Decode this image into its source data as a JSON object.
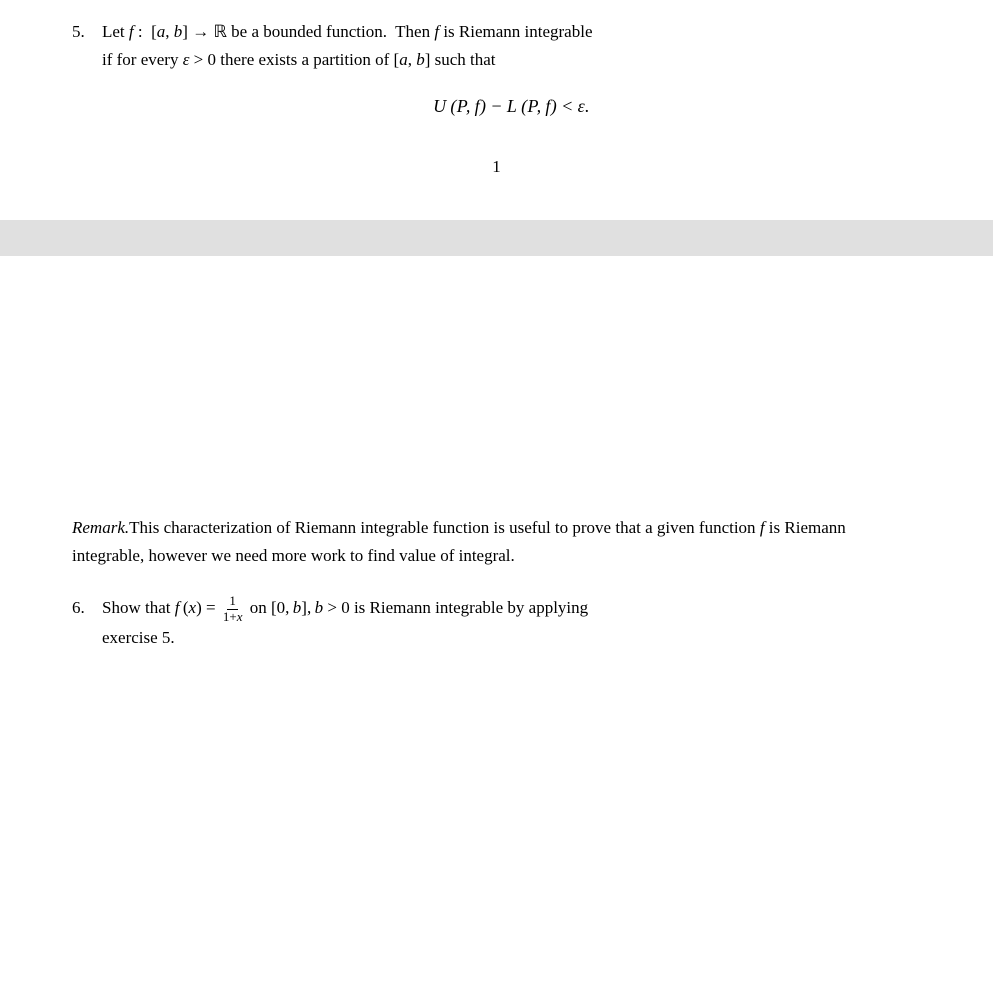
{
  "top": {
    "item5_number": "5.",
    "item5_line1": "Let ",
    "item5_f": "f",
    "item5_colon": " : ",
    "item5_ab": "[a, b]",
    "item5_arrow": " → ℝ",
    "item5_bounded": " be a bounded function.  Then ",
    "item5_f2": "f",
    "item5_riemann": " is Riemann integrable",
    "item5_line2": "if for every ",
    "item5_eps": "ε",
    "item5_gt0": " > 0 there exists a partition of ",
    "item5_ab2": "[a, b]",
    "item5_suchthat": " such that",
    "formula": "U (P, f) − L (P, f) < ε.",
    "page_number": "1"
  },
  "divider": {
    "visible": true
  },
  "bottom": {
    "remark_label": "Remark.",
    "remark_text": "This characterization of Riemann integrable function is useful to prove that a given function ",
    "remark_f": "f",
    "remark_text2": " is Riemann integrable, however we need more work to find value of integral.",
    "item6_number": "6.",
    "item6_show": "Show that ",
    "item6_f": "f",
    "item6_open_paren": " (",
    "item6_x": "x",
    "item6_close_paren": ")",
    "item6_equals": " = ",
    "item6_frac_num": "1",
    "item6_frac_den": "1+x",
    "item6_on": " on ",
    "item6_interval": "[0, b]",
    "item6_b": ", b",
    "item6_rest": " > 0 is Riemann integrable by applying",
    "item6_line2": "exercise 5."
  }
}
